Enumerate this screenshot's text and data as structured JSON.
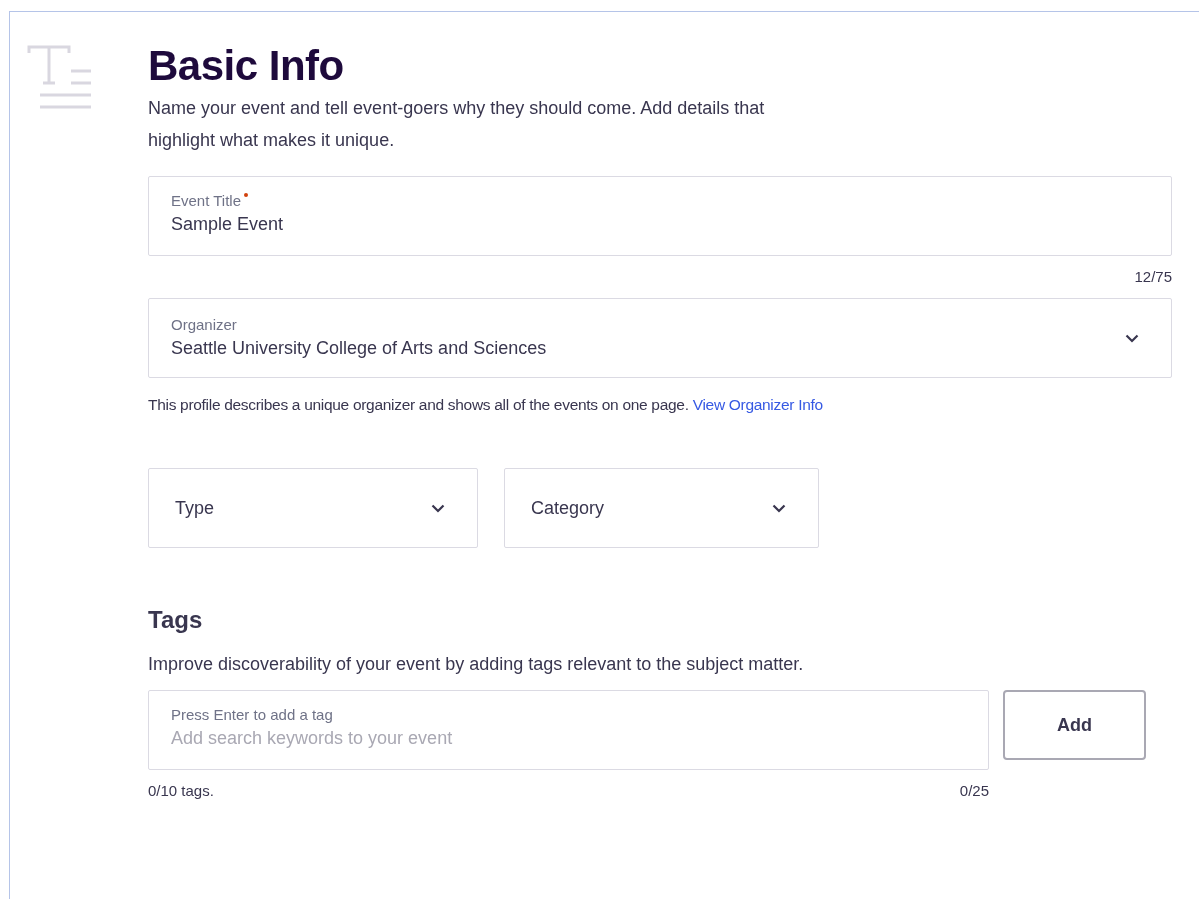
{
  "header": {
    "title": "Basic Info",
    "description": "Name your event and tell event-goers why they should come. Add details that highlight what makes it unique."
  },
  "event_title": {
    "label": "Event Title",
    "required": true,
    "value": "Sample Event",
    "counter": "12/75"
  },
  "organizer": {
    "label": "Organizer",
    "value": "Seattle University College of Arts and Sciences",
    "help": "This profile describes a unique organizer and shows all of the events on one page.",
    "link": "View Organizer Info"
  },
  "selects": [
    {
      "placeholder": "Type"
    },
    {
      "placeholder": "Category"
    }
  ],
  "tags": {
    "title": "Tags",
    "description": "Improve discoverability of your event by adding tags relevant to the subject matter.",
    "label": "Press Enter to add a tag",
    "placeholder": "Add search keywords to your event",
    "button": "Add",
    "tag_count": "0/10 tags.",
    "char_count": "0/25"
  }
}
